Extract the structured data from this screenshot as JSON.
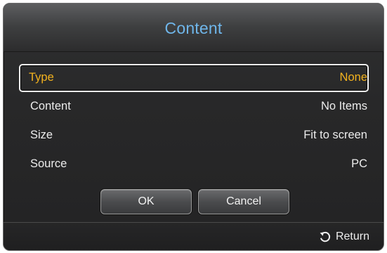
{
  "dialog": {
    "title": "Content"
  },
  "rows": [
    {
      "label": "Type",
      "value": "None"
    },
    {
      "label": "Content",
      "value": "No Items"
    },
    {
      "label": "Size",
      "value": "Fit to screen"
    },
    {
      "label": "Source",
      "value": "PC"
    }
  ],
  "buttons": {
    "ok": "OK",
    "cancel": "Cancel"
  },
  "footer": {
    "return_label": "Return",
    "return_icon": "return-arrow-icon"
  },
  "colors": {
    "title": "#6fb6ea",
    "selected_text": "#f3b21e",
    "text": "#ececec"
  }
}
